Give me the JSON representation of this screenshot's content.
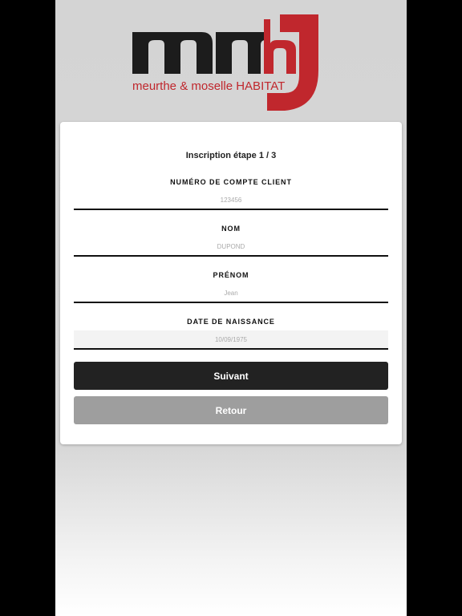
{
  "brand": {
    "logo_text": "mmh",
    "tagline": "meurthe & moselle HABITAT",
    "colors": {
      "dark": "#1c1c1c",
      "red": "#c0272d"
    }
  },
  "form": {
    "step_title": "Inscription étape 1 / 3",
    "fields": [
      {
        "label": "NUMÉRO DE COMPTE CLIENT",
        "placeholder": "123456"
      },
      {
        "label": "NOM",
        "placeholder": "DUPOND"
      },
      {
        "label": "PRÉNOM",
        "placeholder": "Jean"
      },
      {
        "label": "DATE DE NAISSANCE",
        "placeholder": "10/09/1975"
      }
    ],
    "next_label": "Suivant",
    "back_label": "Retour"
  }
}
